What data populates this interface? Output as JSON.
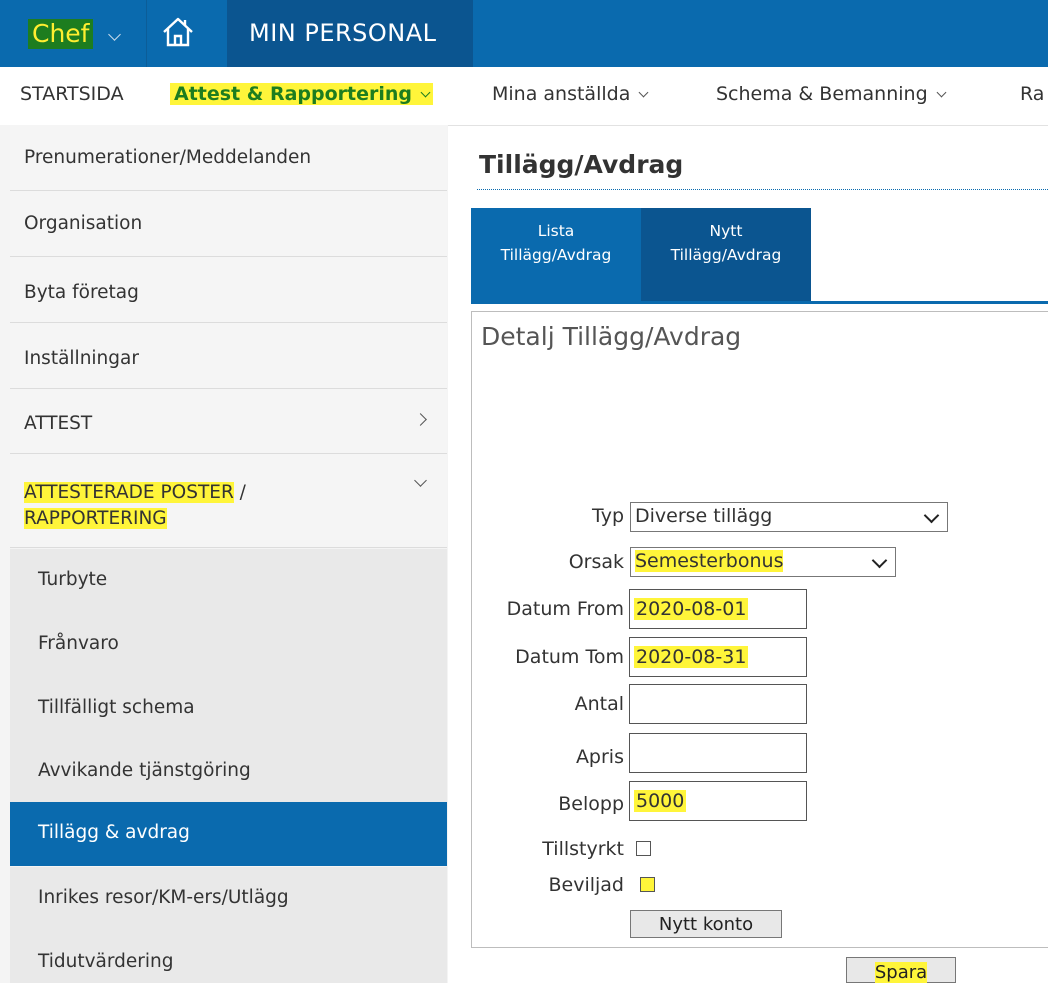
{
  "topbar": {
    "role": "Chef",
    "home_icon": "home-icon",
    "app_title": "MIN PERSONAL"
  },
  "nav": {
    "items": [
      {
        "label": "STARTSIDA"
      },
      {
        "label": "Attest & Rapportering",
        "highlighted": true
      },
      {
        "label": "Mina anställda"
      },
      {
        "label": "Schema & Bemanning"
      },
      {
        "label": "Ra"
      }
    ]
  },
  "sidebar": {
    "items": [
      {
        "label": "Prenumerationer/Meddelanden"
      },
      {
        "label": "Organisation"
      },
      {
        "label": "Byta företag"
      },
      {
        "label": "Inställningar"
      },
      {
        "label": "ATTEST"
      },
      {
        "label_line1_hl": "ATTESTERADE POSTER",
        "label_line1_rest": " /",
        "label_line2": "RAPPORTERING"
      }
    ],
    "subitems": [
      {
        "label": "Turbyte"
      },
      {
        "label": "Frånvaro"
      },
      {
        "label": "Tillfälligt schema"
      },
      {
        "label": "Avvikande tjänstgöring"
      },
      {
        "label": "Tillägg & avdrag",
        "active": true
      },
      {
        "label": "Inrikes resor/KM-ers/Utlägg"
      },
      {
        "label": "Tidutvärdering"
      }
    ]
  },
  "main": {
    "title": "Tillägg/Avdrag",
    "tabs": [
      {
        "line1": "Lista",
        "line2": "Tillägg/Avdrag"
      },
      {
        "line1": "Nytt",
        "line2": "Tillägg/Avdrag"
      }
    ],
    "panel_title": "Detalj Tillägg/Avdrag",
    "form": {
      "typ_label": "Typ",
      "typ_value": "Diverse tillägg",
      "orsak_label": "Orsak",
      "orsak_value": "Semesterbonus",
      "datum_from_label": "Datum From",
      "datum_from_value": "2020-08-01",
      "datum_tom_label": "Datum Tom",
      "datum_tom_value": "2020-08-31",
      "antal_label": "Antal",
      "antal_value": "",
      "apris_label": "Apris",
      "apris_value": "",
      "belopp_label": "Belopp",
      "belopp_value": "5000",
      "tillstyrkt_label": "Tillstyrkt",
      "tillstyrkt_checked": false,
      "beviljad_label": "Beviljad",
      "beviljad_checked": false,
      "nytt_konto_label": "Nytt konto",
      "spara_label": "Spara"
    }
  },
  "colors": {
    "primary": "#0a6aae",
    "dark_primary": "#0b5590",
    "highlight": "#fff53a",
    "chef_bg": "#1d7d1f"
  }
}
